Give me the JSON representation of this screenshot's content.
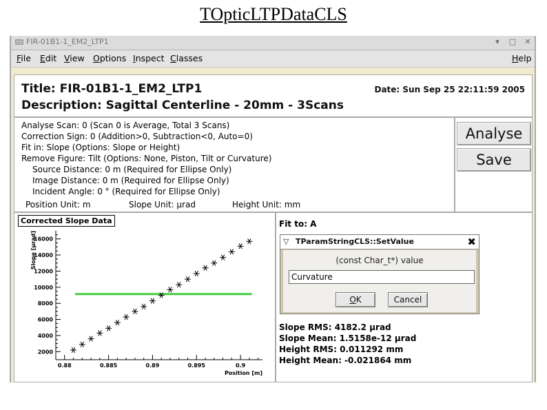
{
  "page_title": "TOpticLTPDataCLS",
  "window": {
    "title": "FIR-01B1-1_EM2_LTP1",
    "menu": [
      {
        "label": "File",
        "u": "F",
        "rest": "ile"
      },
      {
        "label": "Edit",
        "u": "E",
        "rest": "dit"
      },
      {
        "label": "View",
        "u": "V",
        "rest": "iew"
      },
      {
        "label": "Options",
        "u": "O",
        "rest": "ptions"
      },
      {
        "label": "Inspect",
        "u": "I",
        "rest": "nspect"
      },
      {
        "label": "Classes",
        "u": "C",
        "rest": "lasses"
      },
      {
        "label": "Help",
        "u": "H",
        "rest": "elp"
      }
    ]
  },
  "info": {
    "title": "Title: FIR-01B1-1_EM2_LTP1",
    "description": "Description: Sagittal Centerline - 20mm - 3Scans",
    "date": "Date: Sun Sep 25 22:11:59 2005"
  },
  "params": {
    "analyse_scan": "Analyse Scan: 0   (Scan 0 is Average, Total 3 Scans)",
    "correction_sign": "Correction Sign: 0  (Addition>0, Subtraction<0, Auto=0)",
    "fit_in": "Fit in: Slope  (Options: Slope or Height)",
    "remove_figure": "Remove Figure: Tilt   (Options: None, Piston, Tilt or Curvature)",
    "source_distance": "Source Distance: 0 m    (Required for Ellipse Only)",
    "image_distance": "Image Distance: 0 m    (Required for Ellipse Only)",
    "incident_angle": "Incident Angle: 0 °    (Required for Ellipse Only)",
    "position_unit": "Position Unit: m",
    "slope_unit": "Slope Unit: µrad",
    "height_unit": "Height Unit: mm"
  },
  "buttons": {
    "analyse": "Analyse",
    "save": "Save"
  },
  "chart_panel": {
    "label": "Corrected Slope Data"
  },
  "stats": {
    "fit_to": "Fit to: A",
    "slope_rms": "Slope RMS: 4182.2 µrad",
    "slope_mean": "Slope Mean: 1.5158e-12 µrad",
    "height_rms": "Height RMS: 0.011292 mm",
    "height_mean": "Height Mean: -0.021864 mm"
  },
  "dialog": {
    "title": "TParamStringCLS::SetValue",
    "prompt": "(const Char_t*)  value",
    "value": "Curvature",
    "ok": "OK",
    "cancel": "Cancel"
  },
  "colors": {
    "window_bg": "#f0ebcf",
    "fit_line": "#44cc44"
  },
  "chart_data": {
    "type": "scatter",
    "xlabel": "Position [m]",
    "ylabel": "Slope [µrad]",
    "x_ticks": [
      "0.88",
      "0.885",
      "0.89",
      "0.895",
      "0.9"
    ],
    "x_tick_values": [
      0.88,
      0.885,
      0.89,
      0.895,
      0.9
    ],
    "y_ticks": [
      "2000",
      "4000",
      "6000",
      "8000",
      "10000",
      "12000",
      "14000",
      "16000"
    ],
    "y_tick_values": [
      2000,
      4000,
      6000,
      8000,
      10000,
      12000,
      14000,
      16000
    ],
    "xlim": [
      0.879,
      0.9025
    ],
    "ylim": [
      1000,
      17000
    ],
    "series": [
      {
        "marker": "asterisk",
        "x": [
          0.881,
          0.882,
          0.883,
          0.884,
          0.885,
          0.886,
          0.887,
          0.888,
          0.889,
          0.89,
          0.891,
          0.892,
          0.893,
          0.894,
          0.895,
          0.896,
          0.897,
          0.898,
          0.899,
          0.9,
          0.901
        ],
        "y": [
          2200,
          2900,
          3600,
          4300,
          4900,
          5600,
          6300,
          7000,
          7600,
          8300,
          9000,
          9700,
          10300,
          11000,
          11700,
          12400,
          13000,
          13700,
          14400,
          15100,
          15700
        ]
      },
      {
        "type": "line",
        "x": [
          0.8812,
          0.9013
        ],
        "y": [
          9150,
          9150
        ]
      }
    ]
  }
}
